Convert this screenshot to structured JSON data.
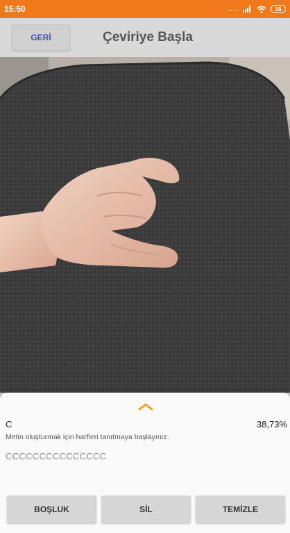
{
  "status_bar": {
    "time": "15:50",
    "dots": "....",
    "battery": "18"
  },
  "header": {
    "back_label": "GERİ",
    "title": "Çeviriye Başla"
  },
  "result": {
    "letter": "C",
    "confidence": "38,73%",
    "hint": "Metin oluşturmak için harfleri tanıtmaya başlayınız.",
    "output": "CCCCCCCCCCCCCCC"
  },
  "buttons": {
    "space": "BOŞLUK",
    "delete": "SİL",
    "clear": "TEMİZLE"
  },
  "colors": {
    "status_bar": "#f07a1a",
    "accent": "#f0a020",
    "back_text": "#3f51b5"
  }
}
